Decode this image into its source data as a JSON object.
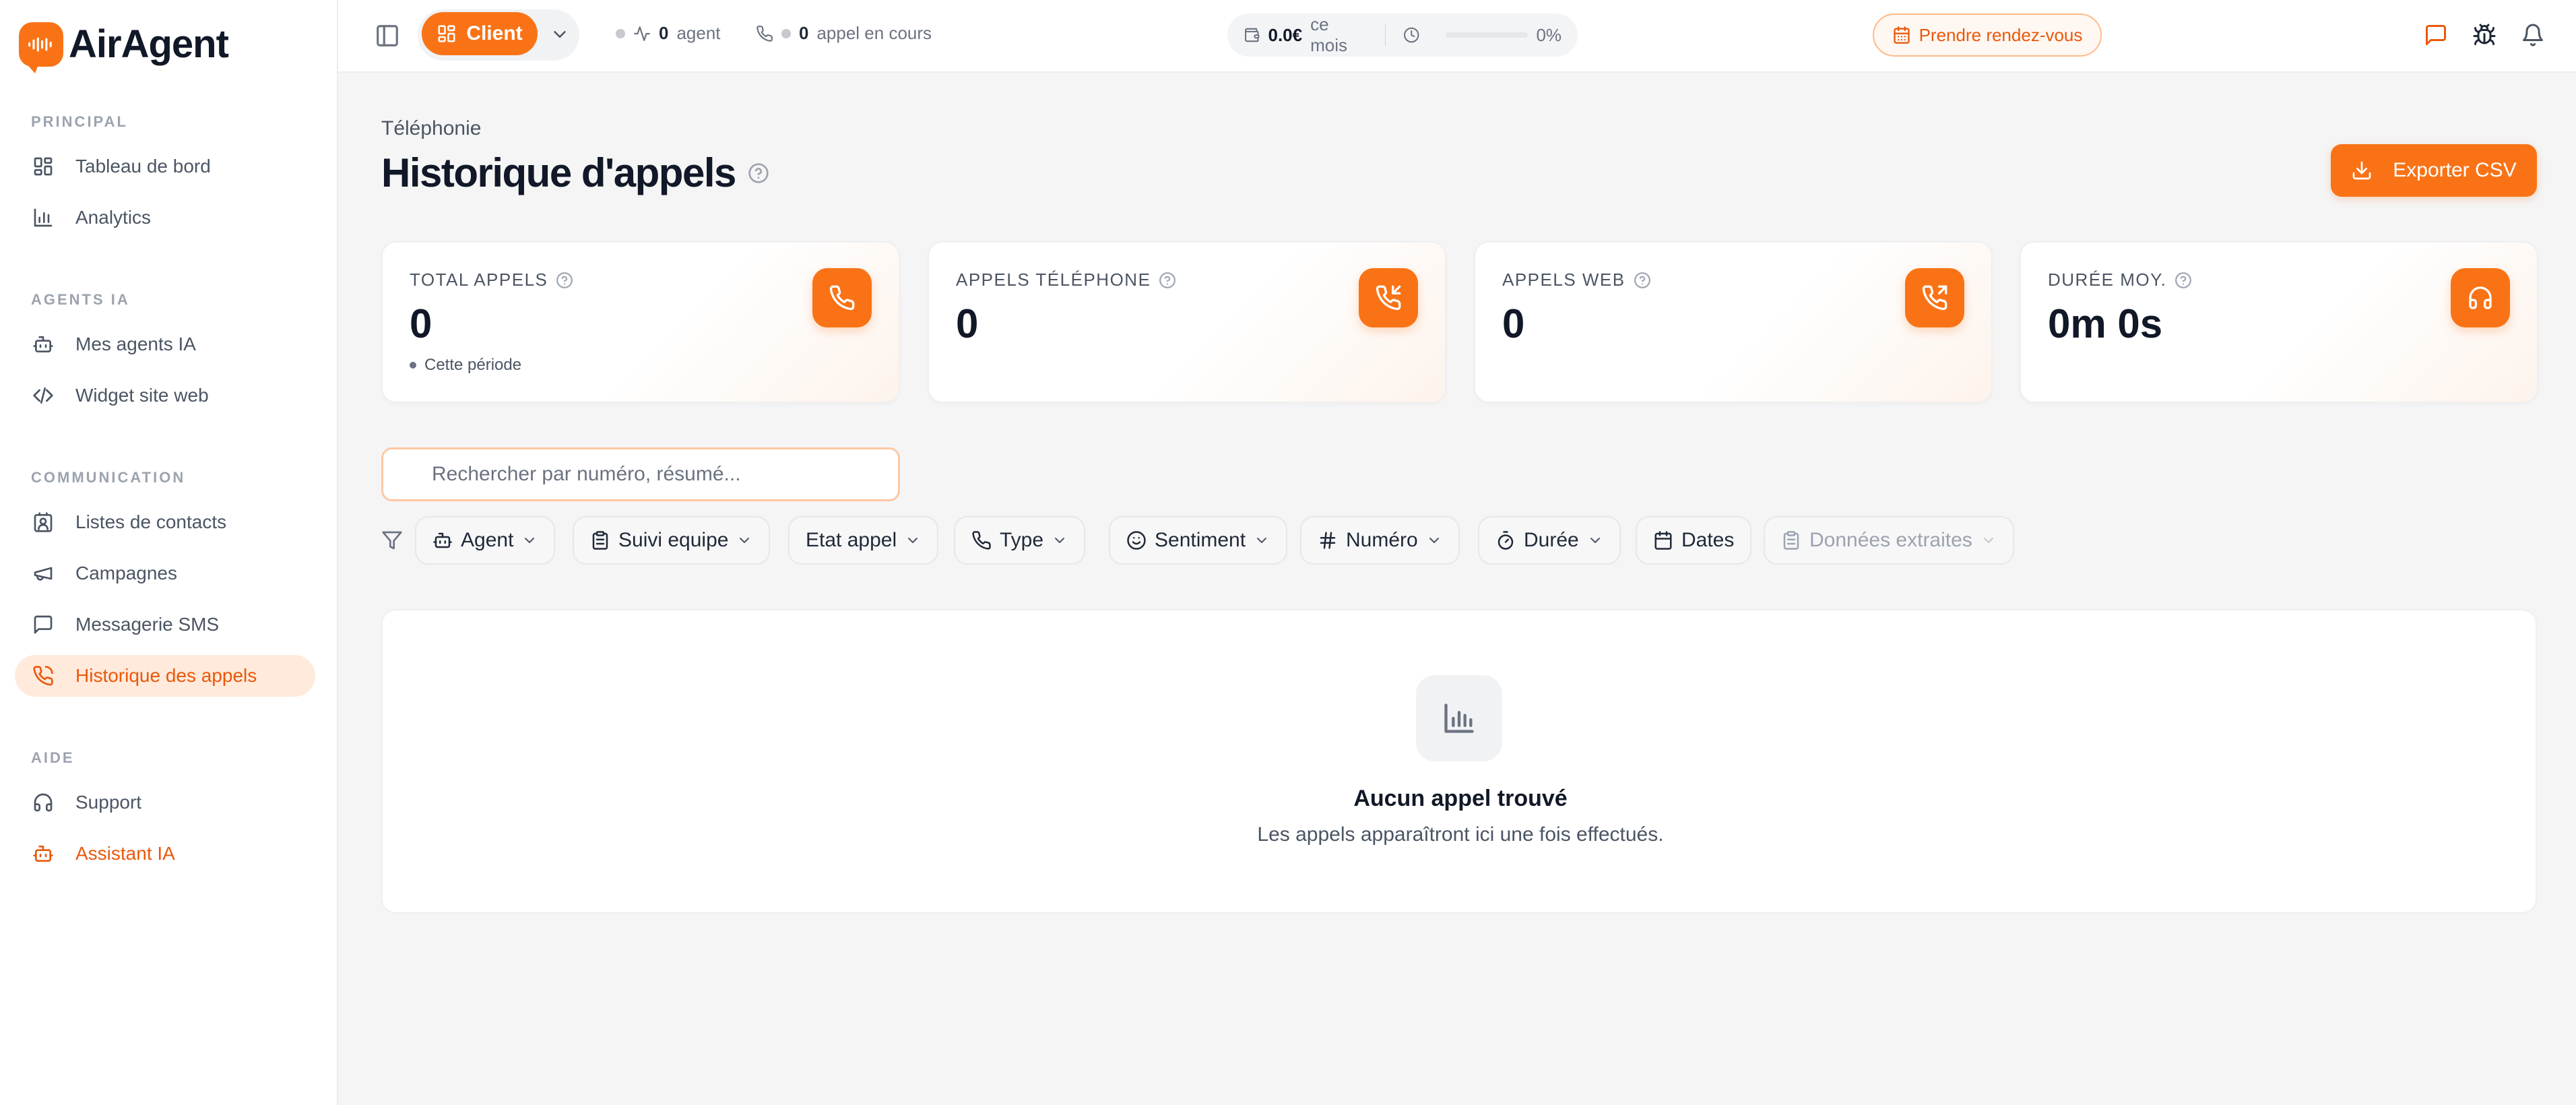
{
  "app": {
    "name": "AirAgent"
  },
  "sidebar": {
    "sections": [
      {
        "title": "PRINCIPAL",
        "items": [
          {
            "label": "Tableau de bord",
            "icon": "dashboard-icon"
          },
          {
            "label": "Analytics",
            "icon": "bar-chart-icon"
          }
        ]
      },
      {
        "title": "AGENTS IA",
        "items": [
          {
            "label": "Mes agents IA",
            "icon": "bot-icon"
          },
          {
            "label": "Widget site web",
            "icon": "code-icon"
          }
        ]
      },
      {
        "title": "COMMUNICATION",
        "items": [
          {
            "label": "Listes de contacts",
            "icon": "contact-icon"
          },
          {
            "label": "Campagnes",
            "icon": "megaphone-icon"
          },
          {
            "label": "Messagerie SMS",
            "icon": "message-icon"
          },
          {
            "label": "Historique des appels",
            "icon": "phone-icon",
            "active": true
          }
        ]
      },
      {
        "title": "AIDE",
        "items": [
          {
            "label": "Support",
            "icon": "headphones-icon"
          },
          {
            "label": "Assistant IA",
            "icon": "bot-icon"
          }
        ]
      }
    ]
  },
  "topbar": {
    "client_label": "Client",
    "agents_count": "0",
    "agents_label": "agent",
    "calls_count": "0",
    "calls_label": "appel en cours",
    "usage_amount": "0.0€",
    "usage_period": "ce mois",
    "usage_percent": "0%",
    "usage_progress": 0,
    "appointment_label": "Prendre rendez-vous"
  },
  "page": {
    "breadcrumb": "Téléphonie",
    "title": "Historique d'appels",
    "export_label": "Exporter CSV"
  },
  "stats": [
    {
      "label": "TOTAL APPELS",
      "value": "0",
      "sub": "Cette période",
      "icon": "phone-icon"
    },
    {
      "label": "APPELS TÉLÉPHONE",
      "value": "0",
      "icon": "phone-incoming-icon"
    },
    {
      "label": "APPELS WEB",
      "value": "0",
      "icon": "phone-outgoing-icon"
    },
    {
      "label": "DURÉE MOY.",
      "value": "0m 0s",
      "icon": "headphones-icon"
    }
  ],
  "search": {
    "placeholder": "Rechercher par numéro, résumé..."
  },
  "filters": [
    {
      "label": "Agent",
      "icon": "bot-icon"
    },
    {
      "label": "Suivi equipe",
      "icon": "clipboard-icon"
    },
    {
      "label": "Etat appel"
    },
    {
      "label": "Type",
      "icon": "phone-icon"
    },
    {
      "label": "Sentiment",
      "icon": "smile-icon"
    },
    {
      "label": "Numéro",
      "icon": "hash-icon"
    },
    {
      "label": "Durée",
      "icon": "timer-icon"
    },
    {
      "label": "Dates",
      "icon": "calendar-icon"
    },
    {
      "label": "Données extraites",
      "icon": "clipboard-icon",
      "disabled": true
    }
  ],
  "empty": {
    "title": "Aucun appel trouvé",
    "subtitle": "Les appels apparaîtront ici une fois effectués."
  },
  "colors": {
    "accent": "#f97316",
    "accent_dark": "#ea580c",
    "active_bg": "#ffeadb"
  }
}
